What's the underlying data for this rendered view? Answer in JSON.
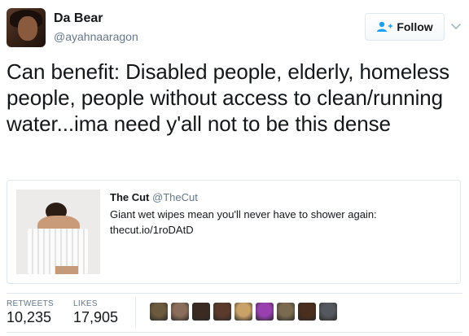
{
  "author": {
    "name": "Da Bear",
    "handle": "@ayahnaaragon"
  },
  "follow_button": {
    "label": "Follow"
  },
  "tweet": {
    "text": "Can benefit: Disabled people, elderly, homeless people, people without access to clean/running water...ima need y'all not to be this dense"
  },
  "quoted_tweet": {
    "name": "The Cut",
    "handle": "@TheCut",
    "text": "Giant wet wipes mean you'll never have to shower again:",
    "link": "thecut.io/1roDAtD"
  },
  "stats": {
    "retweets_label": "RETWEETS",
    "retweets_value": "10,235",
    "likes_label": "LIKES",
    "likes_value": "17,905"
  },
  "liker_colors": [
    "#6b5a3e",
    "#8a6d5a",
    "#3a2a22",
    "#5b3a2c",
    "#c9a26a",
    "#9a3fb0",
    "#7a6a50",
    "#4a2e1e",
    "#55585e"
  ]
}
